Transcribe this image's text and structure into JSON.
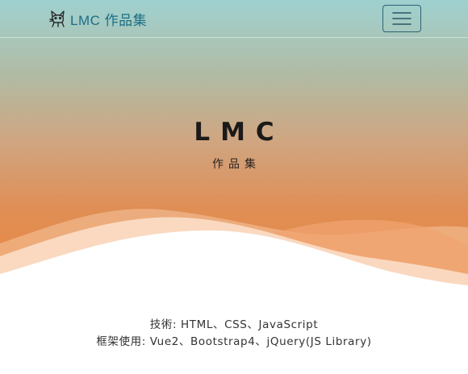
{
  "navbar": {
    "brand_text": "LMC 作品集",
    "logo_icon": "cat-logo-icon",
    "menu_icon": "hamburger-menu-icon"
  },
  "hero": {
    "title": "LMC",
    "subtitle": "作品集"
  },
  "info": {
    "tech_line": "技術: HTML、CSS、JavaScript",
    "framework_line": "框架使用: Vue2、Bootstrap4、jQuery(JS Library)"
  },
  "colors": {
    "gradient_top": "#9fd1d0",
    "gradient_bottom": "#ea8840",
    "brand": "#1c6f86",
    "toggle_border": "#2b6275"
  }
}
